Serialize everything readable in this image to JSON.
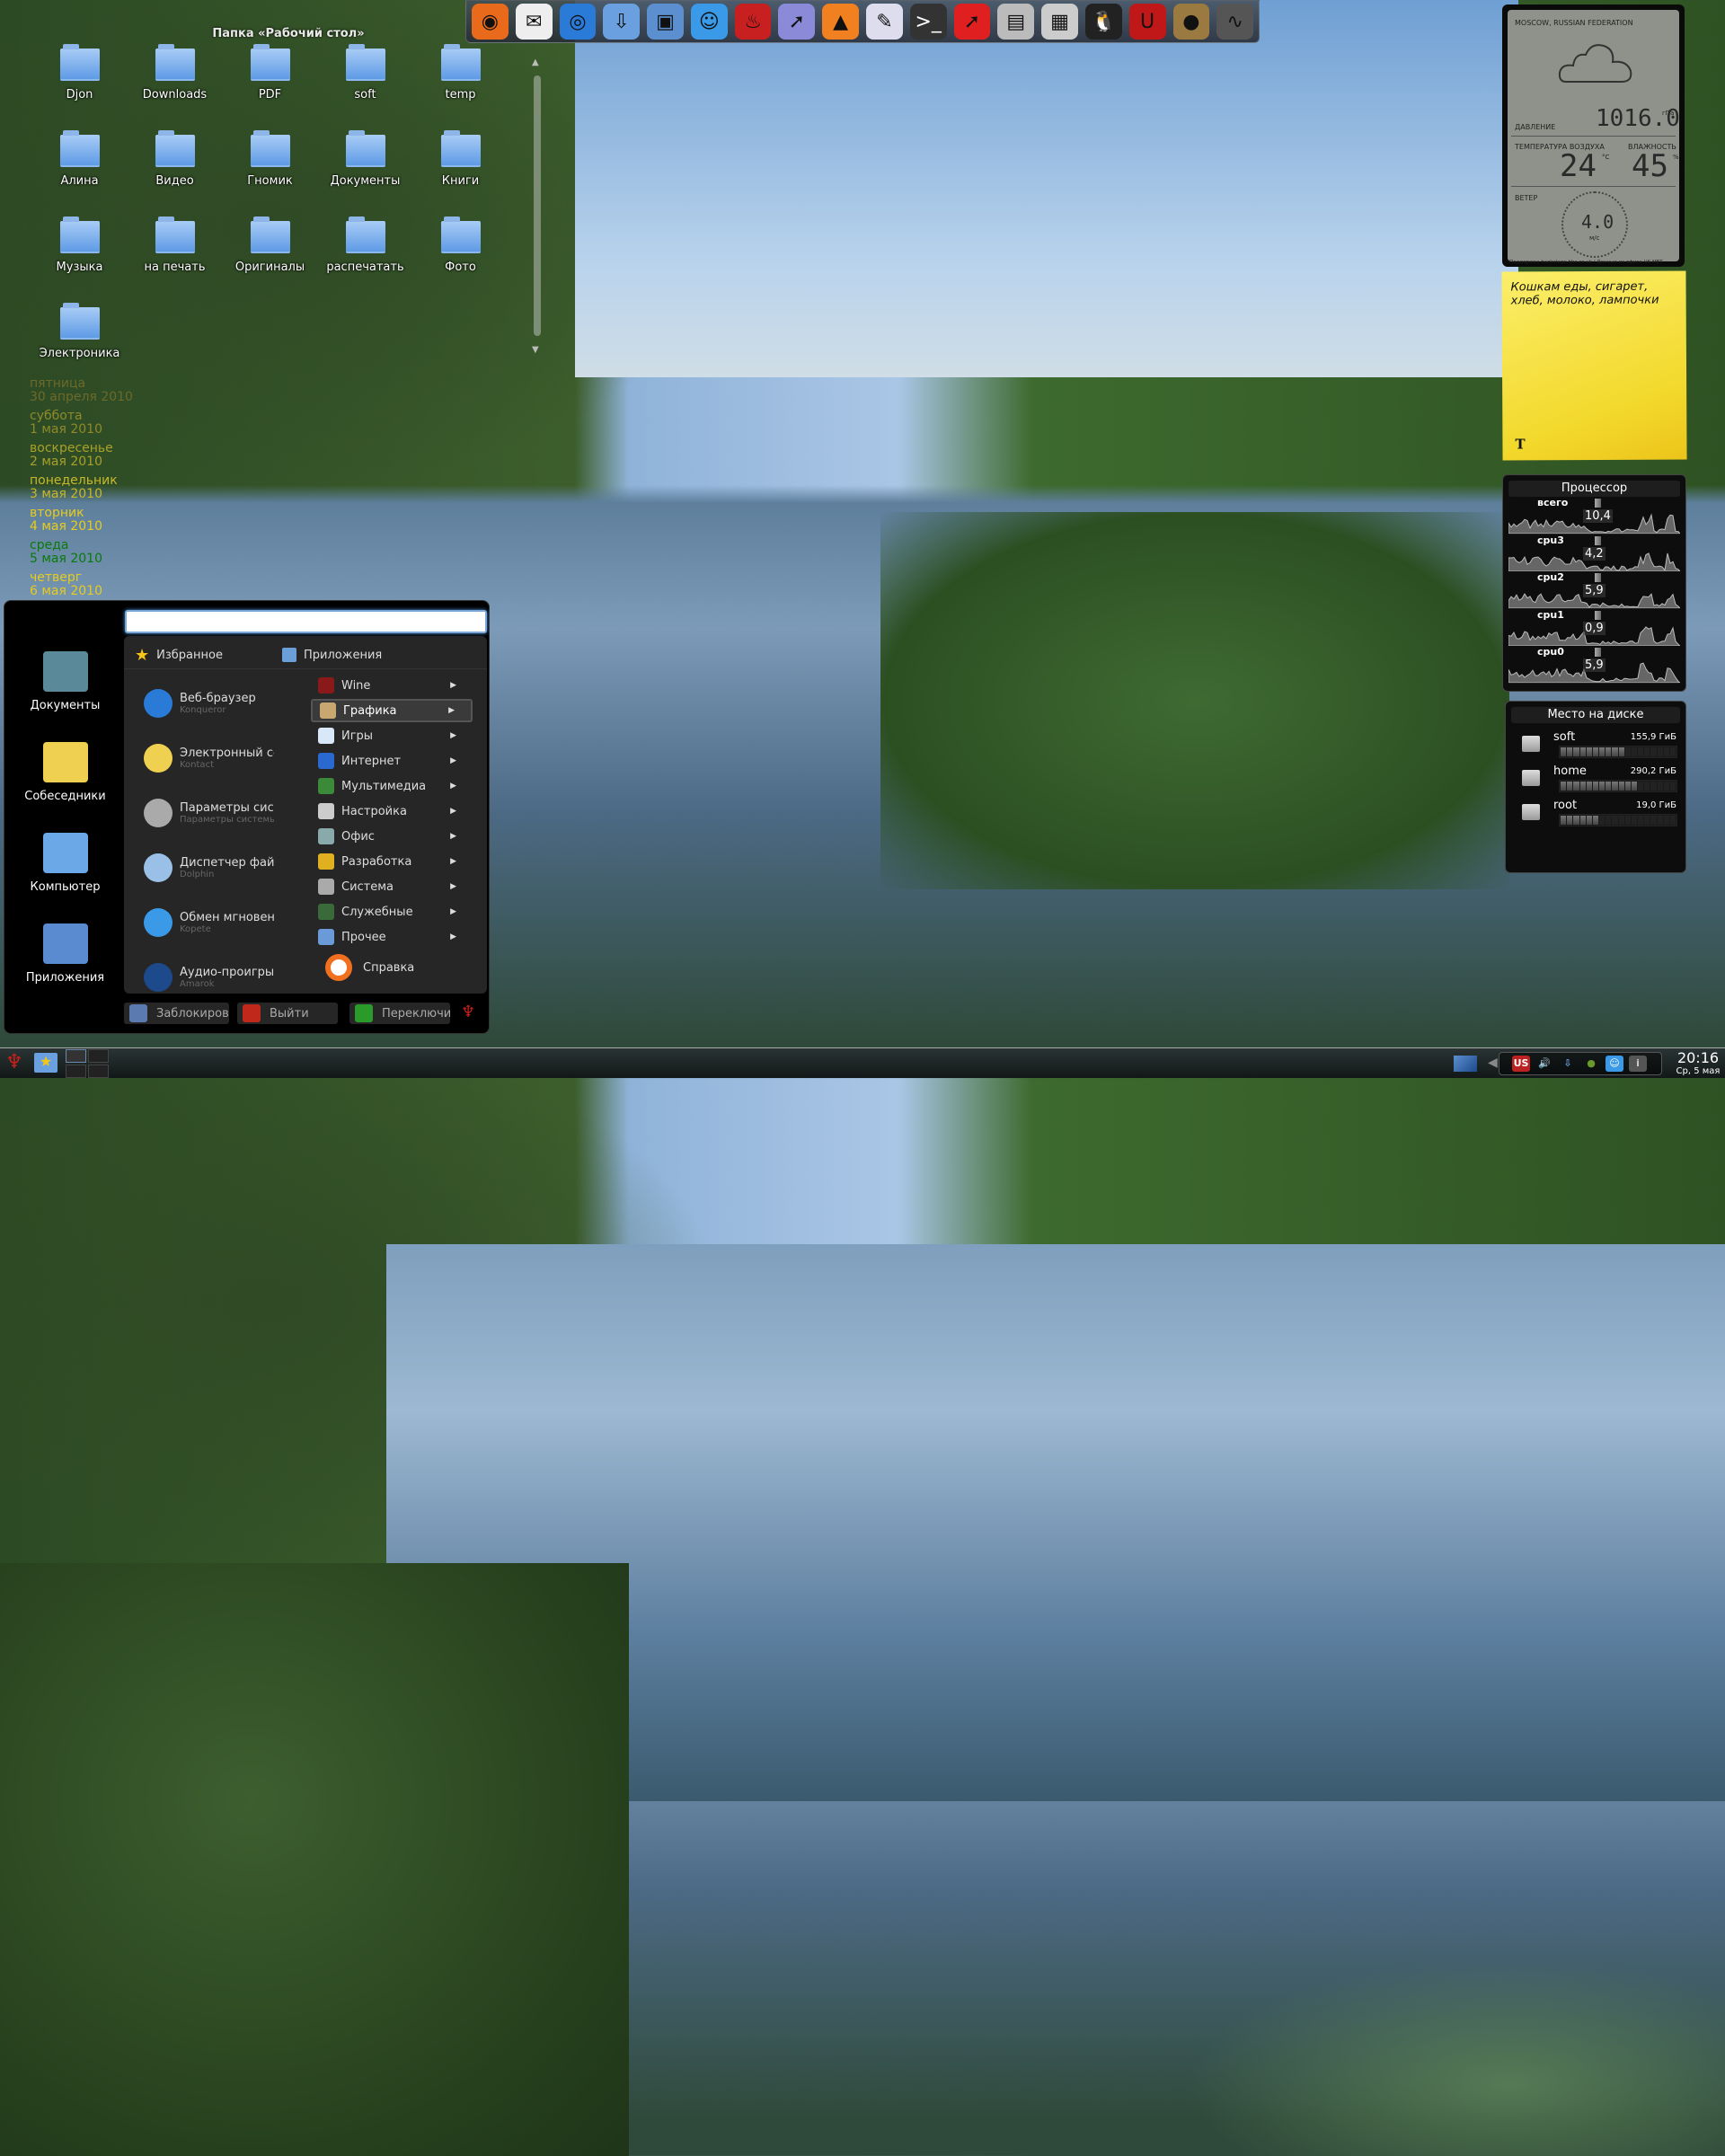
{
  "desktop": {
    "folder_view": {
      "title": "Папка «Рабочий стол»",
      "items": [
        "Djon",
        "Downloads",
        "PDF",
        "soft",
        "temp",
        "Алина",
        "Видео",
        "Гномик",
        "Документы",
        "Книги",
        "Музыка",
        "на печать",
        "Оригиналы",
        "распечатать",
        "Фото",
        "Электроника"
      ]
    },
    "dock": {
      "icons": [
        "firefox-icon",
        "mail-icon",
        "browser-icon",
        "download-icon",
        "network-icon",
        "kopete-icon",
        "ktorrent-icon",
        "kmenu-edit-icon",
        "vlc-icon",
        "office-icon",
        "terminal-icon",
        "pointer-icon",
        "package-icon",
        "calculator-icon",
        "tux-icon",
        "opera-unite-icon",
        "tor-icon",
        "system-monitor-icon"
      ]
    },
    "calendar": [
      {
        "weekday": "пятница",
        "date": "30 апреля 2010",
        "color": "#6d6a2a"
      },
      {
        "weekday": "суббота",
        "date": "1 мая 2010",
        "color": "#8f8a2a"
      },
      {
        "weekday": "воскресенье",
        "date": "2 мая 2010",
        "color": "#a8a02a"
      },
      {
        "weekday": "понедельник",
        "date": "3 мая 2010",
        "color": "#c8b82a"
      },
      {
        "weekday": "вторник",
        "date": "4 мая 2010",
        "color": "#e6cc1e"
      },
      {
        "weekday": "среда",
        "date": "5 мая 2010",
        "color": "#0a7a0a"
      },
      {
        "weekday": "четверг",
        "date": "6 мая 2010",
        "color": "#e6cc1e"
      }
    ]
  },
  "menu": {
    "left": [
      "Документы",
      "Собеседники",
      "Компьютер",
      "Приложения"
    ],
    "search": {
      "value": "",
      "placeholder": ""
    },
    "tabs": {
      "favorites": "Избранное",
      "applications": "Приложения"
    },
    "favorites": [
      {
        "title": "Веб-браузер",
        "sub": "Konqueror"
      },
      {
        "title": "Электронный секретарь",
        "sub": "Kontact"
      },
      {
        "title": "Параметры системы",
        "sub": "Параметры системы"
      },
      {
        "title": "Диспетчер файлов",
        "sub": "Dolphin"
      },
      {
        "title": "Обмен мгновенными сообщениями",
        "sub": "Kopete"
      },
      {
        "title": "Аудио-проигрыватель",
        "sub": "Amarok"
      }
    ],
    "applications": [
      "Wine",
      "Графика",
      "Игры",
      "Интернет",
      "Мультимедиа",
      "Настройка",
      "Офис",
      "Разработка",
      "Система",
      "Служебные",
      "Прочее"
    ],
    "selected_application": "Графика",
    "help": "Справка",
    "buttons": {
      "lock": "Заблокировать",
      "logout": "Выйти",
      "switch": "Переключить"
    }
  },
  "weather": {
    "location": "MOSCOW, RUSSIAN FEDERATION",
    "condition_icon": "cloud-icon",
    "pressure_label": "ДАВЛЕНИЕ",
    "pressure": "1016.0",
    "pressure_unit": "гПа",
    "temp_label": "ТЕМПЕРАТУРА ВОЗДУХА",
    "temp": "24",
    "temp_unit": "°C",
    "humidity_label": "ВЛАЖНОСТЬ",
    "humidity": "45",
    "humidity_unit": "%",
    "wind_label": "ВЕТЕР",
    "wind": "4.0",
    "wind_unit": "м/с",
    "credits": "Поддержка backstage.bbc.co.uk / Данные из офиса UK MET"
  },
  "sticky_note": {
    "text": "Кошкам еды, сигарет, хлеб, молоко, лампочки"
  },
  "cpu": {
    "title": "Процессор",
    "rows": [
      {
        "label": "всего",
        "value": "10,4"
      },
      {
        "label": "cpu3",
        "value": "4,2"
      },
      {
        "label": "cpu2",
        "value": "5,9"
      },
      {
        "label": "cpu1",
        "value": "0,9"
      },
      {
        "label": "cpu0",
        "value": "5,9"
      }
    ]
  },
  "disk": {
    "title": "Место на диске",
    "rows": [
      {
        "name": "soft",
        "size": "155,9 ГиБ",
        "used_fraction": 0.56
      },
      {
        "name": "home",
        "size": "290,2 ГиБ",
        "used_fraction": 0.67
      },
      {
        "name": "root",
        "size": "19,0 ГиБ",
        "used_fraction": 0.33
      }
    ]
  },
  "taskbar": {
    "clock": {
      "time": "20:16",
      "date": "Ср, 5 мая"
    },
    "tray_icons": [
      "keyboard-layout-us-icon",
      "volume-icon",
      "download-icon",
      "tor-icon",
      "kopete-icon",
      "info-icon"
    ]
  }
}
